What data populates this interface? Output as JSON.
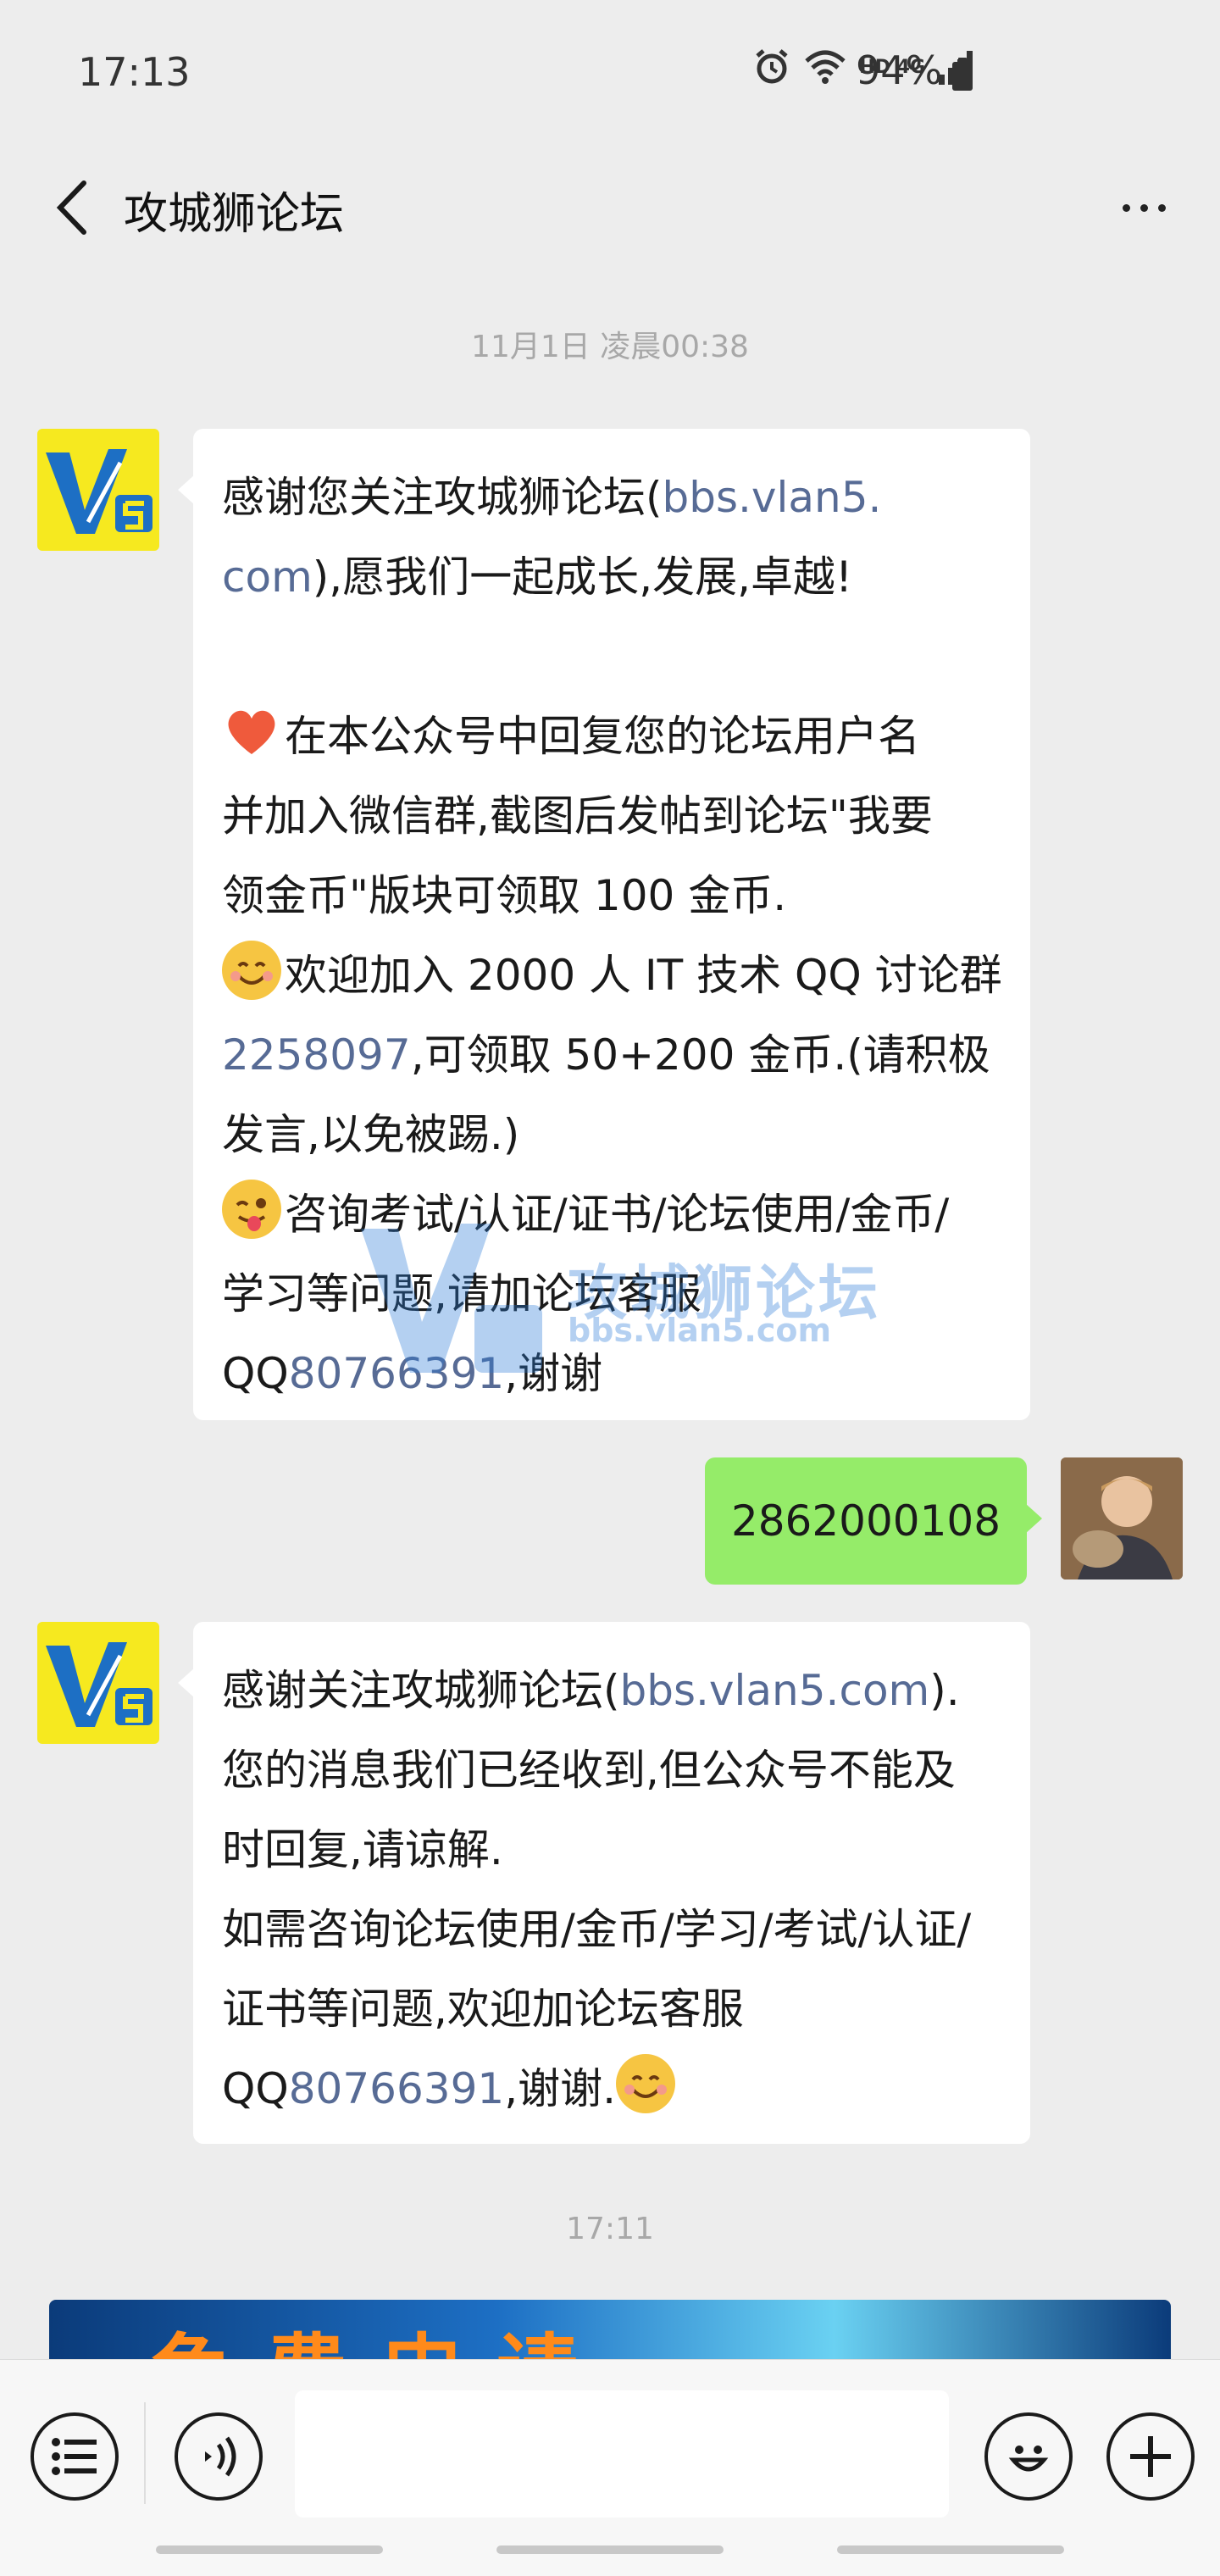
{
  "status_bar": {
    "time": "17:13",
    "network": "HD 4G",
    "battery": "94%"
  },
  "header": {
    "title": "攻城狮论坛"
  },
  "timestamps": {
    "first": "11月1日 凌晨00:38",
    "second": "17:11"
  },
  "messages": [
    {
      "from": "account",
      "lines": [
        [
          "感谢您关注攻城狮论坛(",
          "bbs.vlan5.",
          ""
        ],
        [
          "",
          "com",
          "),愿我们一起成长,发展,卓越!"
        ],
        [
          "",
          "",
          ""
        ],
        [
          "在本公众号中回复您的论坛用户名",
          "",
          ""
        ],
        [
          "并加入微信群,截图后发帖到论坛\"我要",
          "",
          ""
        ],
        [
          "领金币\"版块可领取 100 金币.",
          "",
          ""
        ],
        [
          "欢迎加入 2000 人 IT 技术 QQ 讨论群",
          "",
          ""
        ],
        [
          "",
          "2258097",
          ",可领取 50+200 金币.(请积极"
        ],
        [
          "发言,以免被踢.)",
          "",
          ""
        ],
        [
          "咨询考试/认证/证书/论坛使用/金币/",
          "",
          ""
        ],
        [
          "学习等问题,请加论坛客服",
          "",
          ""
        ],
        [
          "QQ",
          "80766391",
          ",谢谢"
        ]
      ]
    },
    {
      "from": "me",
      "text": "2862000108"
    },
    {
      "from": "account",
      "lines": [
        [
          "感谢关注攻城狮论坛(",
          "bbs.vlan5.com",
          ")."
        ],
        [
          "您的消息我们已经收到,但公众号不能及",
          "",
          ""
        ],
        [
          "时回复,请谅解.",
          "",
          ""
        ],
        [
          "如需咨询论坛使用/金币/学习/考试/认证/",
          "",
          ""
        ],
        [
          "证书等问题,欢迎加论坛客服",
          "",
          ""
        ],
        [
          "QQ",
          "80766391",
          ",谢谢."
        ]
      ]
    }
  ],
  "watermark": {
    "logo_text": "攻城狮论坛",
    "url": "bbs.vlan5.com"
  },
  "banner": {
    "text": "免费申请"
  },
  "input_bar": {
    "placeholder": ""
  },
  "colors": {
    "background": "#ededed",
    "outgoing_bubble": "#95ec69",
    "link": "#576b95",
    "avatar_yellow": "#f6e91f"
  }
}
